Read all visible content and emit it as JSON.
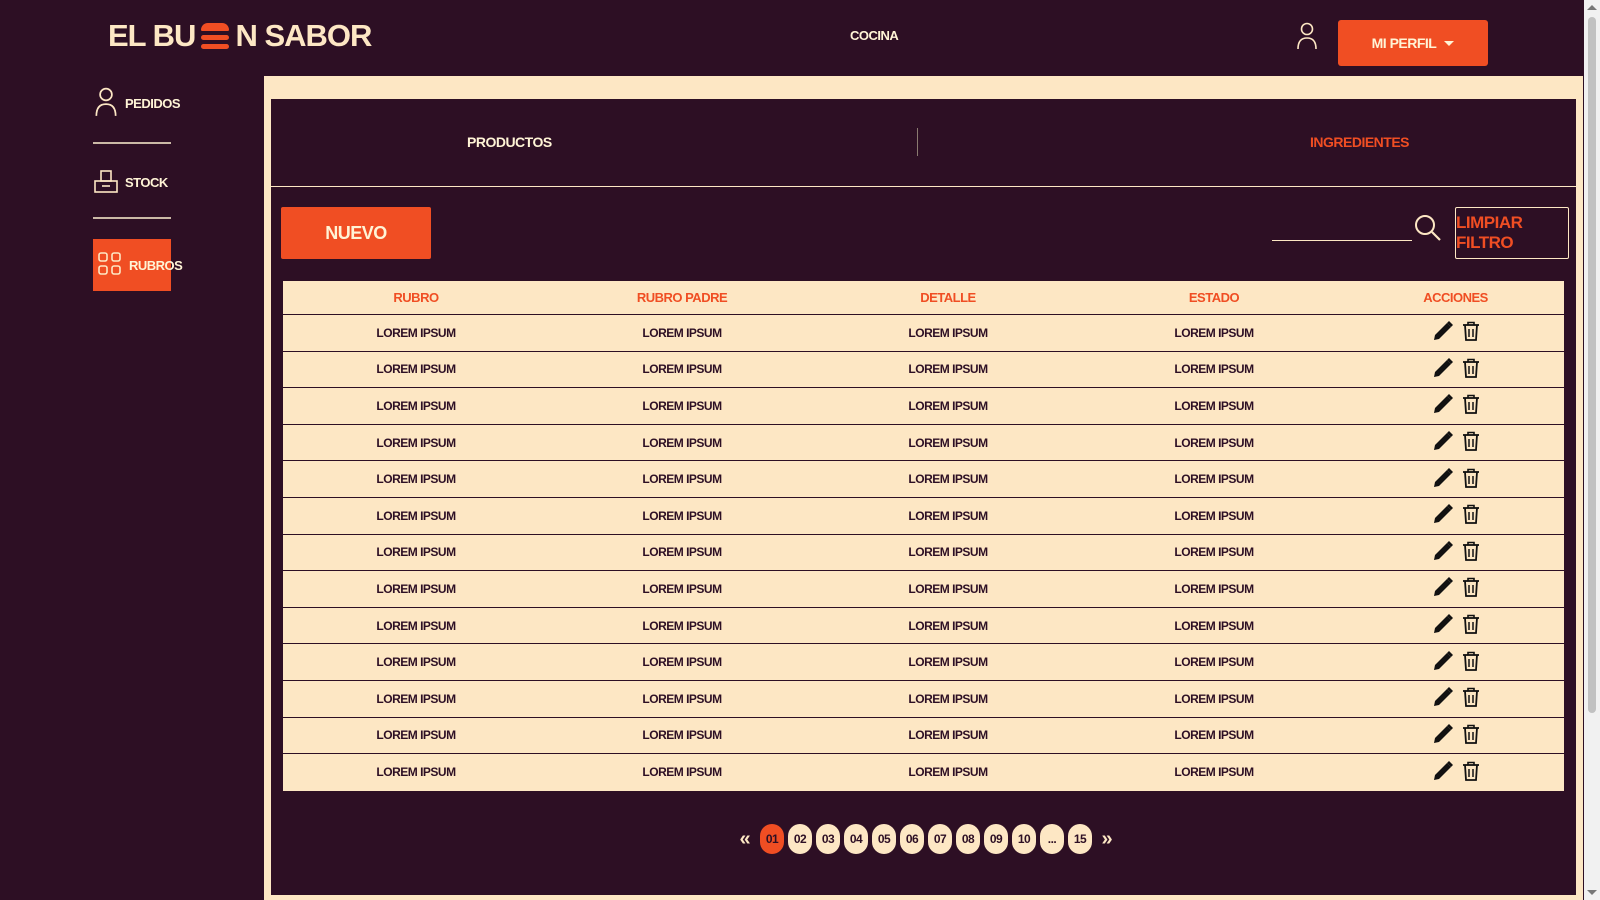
{
  "header": {
    "logo": [
      "EL BU",
      "N SABOR"
    ],
    "nav_link": "COCINA",
    "profile_button": "MI PERFIL"
  },
  "sidebar": {
    "items": [
      {
        "label": "PEDIDOS",
        "icon": "user-icon"
      },
      {
        "label": "STOCK",
        "icon": "box-icon"
      },
      {
        "label": "RUBROS",
        "icon": "grid-icon",
        "active": true
      }
    ]
  },
  "tabs": [
    {
      "label": "PRODUCTOS",
      "active": false
    },
    {
      "label": "INGREDIENTES",
      "active": true
    }
  ],
  "toolbar": {
    "new_button": "NUEVO",
    "search_placeholder": "",
    "clear_filter_button": "LIMPIAR FILTRO"
  },
  "table": {
    "headers": [
      "RUBRO",
      "RUBRO PADRE",
      "DETALLE",
      "ESTADO",
      "ACCIONES"
    ],
    "rows": [
      [
        "LOREM IPSUM",
        "LOREM IPSUM",
        "LOREM IPSUM",
        "LOREM IPSUM"
      ],
      [
        "LOREM IPSUM",
        "LOREM IPSUM",
        "LOREM IPSUM",
        "LOREM IPSUM"
      ],
      [
        "LOREM IPSUM",
        "LOREM IPSUM",
        "LOREM IPSUM",
        "LOREM IPSUM"
      ],
      [
        "LOREM IPSUM",
        "LOREM IPSUM",
        "LOREM IPSUM",
        "LOREM IPSUM"
      ],
      [
        "LOREM IPSUM",
        "LOREM IPSUM",
        "LOREM IPSUM",
        "LOREM IPSUM"
      ],
      [
        "LOREM IPSUM",
        "LOREM IPSUM",
        "LOREM IPSUM",
        "LOREM IPSUM"
      ],
      [
        "LOREM IPSUM",
        "LOREM IPSUM",
        "LOREM IPSUM",
        "LOREM IPSUM"
      ],
      [
        "LOREM IPSUM",
        "LOREM IPSUM",
        "LOREM IPSUM",
        "LOREM IPSUM"
      ],
      [
        "LOREM IPSUM",
        "LOREM IPSUM",
        "LOREM IPSUM",
        "LOREM IPSUM"
      ],
      [
        "LOREM IPSUM",
        "LOREM IPSUM",
        "LOREM IPSUM",
        "LOREM IPSUM"
      ],
      [
        "LOREM IPSUM",
        "LOREM IPSUM",
        "LOREM IPSUM",
        "LOREM IPSUM"
      ],
      [
        "LOREM IPSUM",
        "LOREM IPSUM",
        "LOREM IPSUM",
        "LOREM IPSUM"
      ],
      [
        "LOREM IPSUM",
        "LOREM IPSUM",
        "LOREM IPSUM",
        "LOREM IPSUM"
      ]
    ],
    "row_actions": [
      "pencil-icon",
      "trash-icon"
    ]
  },
  "pagination": {
    "prev": "«",
    "next": "»",
    "pages": [
      "01",
      "02",
      "03",
      "04",
      "05",
      "06",
      "07",
      "08",
      "09",
      "10",
      "...",
      "15"
    ],
    "active_page": "01"
  },
  "colors": {
    "background": "#2d0f24",
    "accent": "#f04e23",
    "cream": "#fde7c4"
  }
}
